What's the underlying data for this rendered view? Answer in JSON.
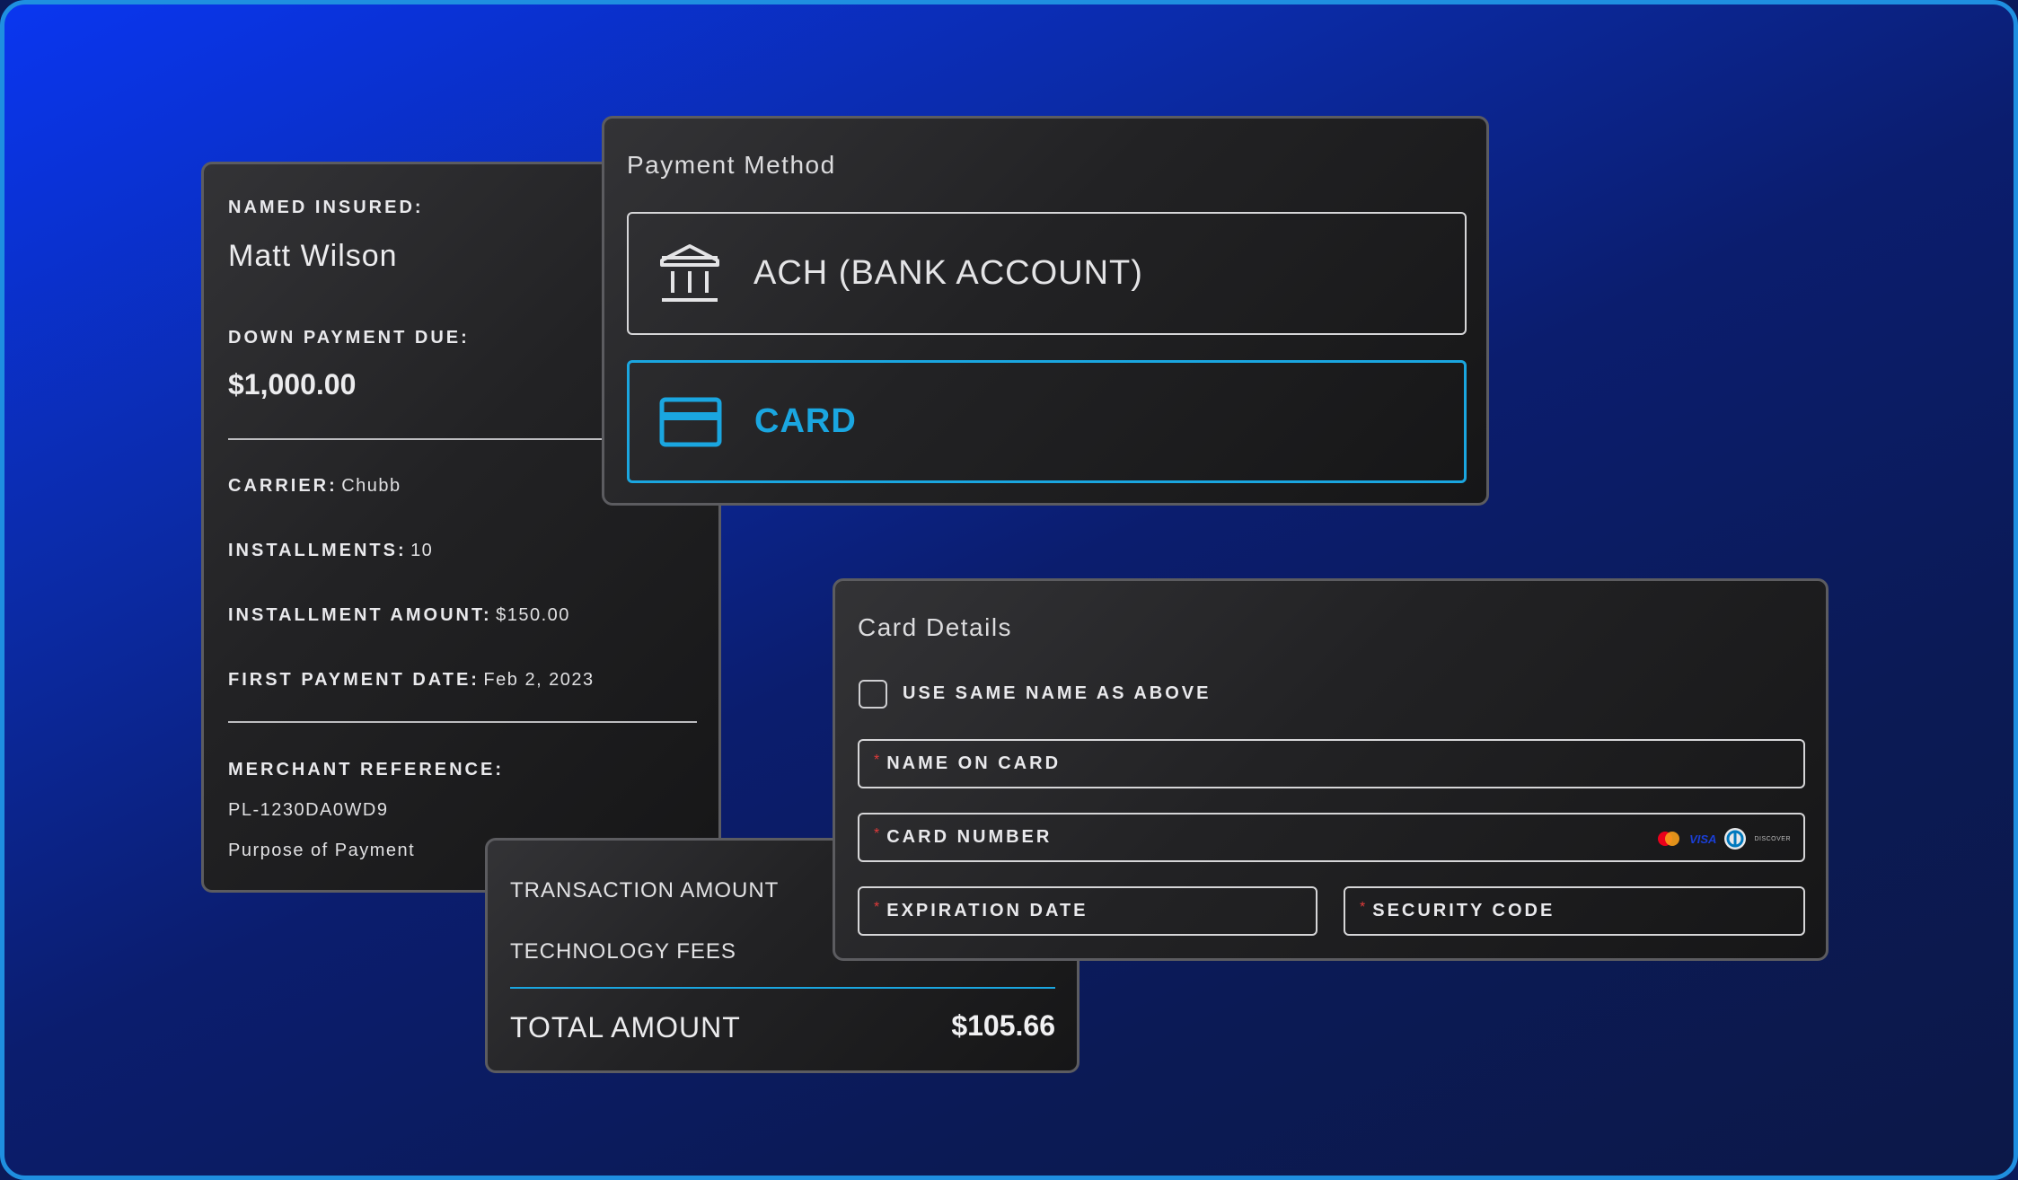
{
  "summary": {
    "named_insured_label": "NAMED INSURED:",
    "named_insured_value": "Matt Wilson",
    "down_payment_label": "DOWN PAYMENT DUE:",
    "down_payment_value": "$1,000.00",
    "carrier_label": "CARRIER:",
    "carrier_value": "Chubb",
    "installments_label": "INSTALLMENTS:",
    "installments_value": "10",
    "installment_amount_label": "INSTALLMENT AMOUNT:",
    "installment_amount_value": "$150.00",
    "first_payment_label": "FIRST PAYMENT DATE:",
    "first_payment_value": "Feb 2, 2023",
    "merchant_reference_label": "MERCHANT REFERENCE:",
    "merchant_reference_value": "PL-1230DA0WD9",
    "purpose_text": "Purpose of Payment"
  },
  "payment_method": {
    "title": "Payment Method",
    "options": [
      {
        "label": "ACH (BANK ACCOUNT)",
        "icon": "bank-icon",
        "selected": false
      },
      {
        "label": "CARD",
        "icon": "credit-card-icon",
        "selected": true
      }
    ]
  },
  "totals": {
    "transaction_amount_label": "TRANSACTION AMOUNT",
    "technology_fees_label": "TECHNOLOGY FEES",
    "total_label": "TOTAL AMOUNT",
    "total_value": "$105.66"
  },
  "card_details": {
    "title": "Card Details",
    "same_name_label": "USE SAME NAME AS ABOVE",
    "same_name_checked": false,
    "name_on_card_label": "NAME ON CARD",
    "card_number_label": "CARD NUMBER",
    "expiration_label": "EXPIRATION DATE",
    "security_code_label": "SECURITY CODE",
    "required_marker": "*",
    "card_brands": [
      "mastercard-icon",
      "visa-icon",
      "diners-club-icon",
      "discover-icon"
    ],
    "visa_text": "VISA",
    "discover_text": "DISCOVER"
  },
  "colors": {
    "accent": "#1aa6e0",
    "required": "#e03a3a",
    "panel_border": "#5c5c60"
  }
}
